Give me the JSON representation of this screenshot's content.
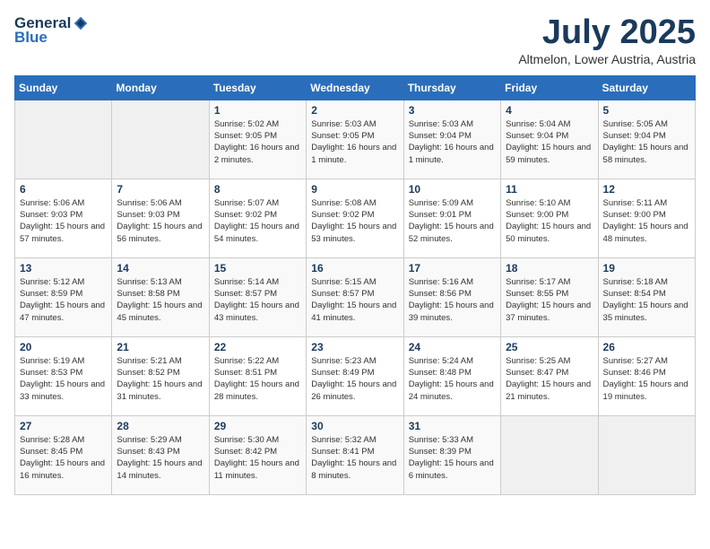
{
  "header": {
    "logo_general": "General",
    "logo_blue": "Blue",
    "title": "July 2025",
    "location": "Altmelon, Lower Austria, Austria"
  },
  "days_of_week": [
    "Sunday",
    "Monday",
    "Tuesday",
    "Wednesday",
    "Thursday",
    "Friday",
    "Saturday"
  ],
  "weeks": [
    [
      {
        "day": "",
        "info": ""
      },
      {
        "day": "",
        "info": ""
      },
      {
        "day": "1",
        "sunrise": "5:02 AM",
        "sunset": "9:05 PM",
        "daylight": "16 hours and 2 minutes."
      },
      {
        "day": "2",
        "sunrise": "5:03 AM",
        "sunset": "9:05 PM",
        "daylight": "16 hours and 1 minute."
      },
      {
        "day": "3",
        "sunrise": "5:03 AM",
        "sunset": "9:04 PM",
        "daylight": "16 hours and 1 minute."
      },
      {
        "day": "4",
        "sunrise": "5:04 AM",
        "sunset": "9:04 PM",
        "daylight": "15 hours and 59 minutes."
      },
      {
        "day": "5",
        "sunrise": "5:05 AM",
        "sunset": "9:04 PM",
        "daylight": "15 hours and 58 minutes."
      }
    ],
    [
      {
        "day": "6",
        "sunrise": "5:06 AM",
        "sunset": "9:03 PM",
        "daylight": "15 hours and 57 minutes."
      },
      {
        "day": "7",
        "sunrise": "5:06 AM",
        "sunset": "9:03 PM",
        "daylight": "15 hours and 56 minutes."
      },
      {
        "day": "8",
        "sunrise": "5:07 AM",
        "sunset": "9:02 PM",
        "daylight": "15 hours and 54 minutes."
      },
      {
        "day": "9",
        "sunrise": "5:08 AM",
        "sunset": "9:02 PM",
        "daylight": "15 hours and 53 minutes."
      },
      {
        "day": "10",
        "sunrise": "5:09 AM",
        "sunset": "9:01 PM",
        "daylight": "15 hours and 52 minutes."
      },
      {
        "day": "11",
        "sunrise": "5:10 AM",
        "sunset": "9:00 PM",
        "daylight": "15 hours and 50 minutes."
      },
      {
        "day": "12",
        "sunrise": "5:11 AM",
        "sunset": "9:00 PM",
        "daylight": "15 hours and 48 minutes."
      }
    ],
    [
      {
        "day": "13",
        "sunrise": "5:12 AM",
        "sunset": "8:59 PM",
        "daylight": "15 hours and 47 minutes."
      },
      {
        "day": "14",
        "sunrise": "5:13 AM",
        "sunset": "8:58 PM",
        "daylight": "15 hours and 45 minutes."
      },
      {
        "day": "15",
        "sunrise": "5:14 AM",
        "sunset": "8:57 PM",
        "daylight": "15 hours and 43 minutes."
      },
      {
        "day": "16",
        "sunrise": "5:15 AM",
        "sunset": "8:57 PM",
        "daylight": "15 hours and 41 minutes."
      },
      {
        "day": "17",
        "sunrise": "5:16 AM",
        "sunset": "8:56 PM",
        "daylight": "15 hours and 39 minutes."
      },
      {
        "day": "18",
        "sunrise": "5:17 AM",
        "sunset": "8:55 PM",
        "daylight": "15 hours and 37 minutes."
      },
      {
        "day": "19",
        "sunrise": "5:18 AM",
        "sunset": "8:54 PM",
        "daylight": "15 hours and 35 minutes."
      }
    ],
    [
      {
        "day": "20",
        "sunrise": "5:19 AM",
        "sunset": "8:53 PM",
        "daylight": "15 hours and 33 minutes."
      },
      {
        "day": "21",
        "sunrise": "5:21 AM",
        "sunset": "8:52 PM",
        "daylight": "15 hours and 31 minutes."
      },
      {
        "day": "22",
        "sunrise": "5:22 AM",
        "sunset": "8:51 PM",
        "daylight": "15 hours and 28 minutes."
      },
      {
        "day": "23",
        "sunrise": "5:23 AM",
        "sunset": "8:49 PM",
        "daylight": "15 hours and 26 minutes."
      },
      {
        "day": "24",
        "sunrise": "5:24 AM",
        "sunset": "8:48 PM",
        "daylight": "15 hours and 24 minutes."
      },
      {
        "day": "25",
        "sunrise": "5:25 AM",
        "sunset": "8:47 PM",
        "daylight": "15 hours and 21 minutes."
      },
      {
        "day": "26",
        "sunrise": "5:27 AM",
        "sunset": "8:46 PM",
        "daylight": "15 hours and 19 minutes."
      }
    ],
    [
      {
        "day": "27",
        "sunrise": "5:28 AM",
        "sunset": "8:45 PM",
        "daylight": "15 hours and 16 minutes."
      },
      {
        "day": "28",
        "sunrise": "5:29 AM",
        "sunset": "8:43 PM",
        "daylight": "15 hours and 14 minutes."
      },
      {
        "day": "29",
        "sunrise": "5:30 AM",
        "sunset": "8:42 PM",
        "daylight": "15 hours and 11 minutes."
      },
      {
        "day": "30",
        "sunrise": "5:32 AM",
        "sunset": "8:41 PM",
        "daylight": "15 hours and 8 minutes."
      },
      {
        "day": "31",
        "sunrise": "5:33 AM",
        "sunset": "8:39 PM",
        "daylight": "15 hours and 6 minutes."
      },
      {
        "day": "",
        "info": ""
      },
      {
        "day": "",
        "info": ""
      }
    ]
  ]
}
